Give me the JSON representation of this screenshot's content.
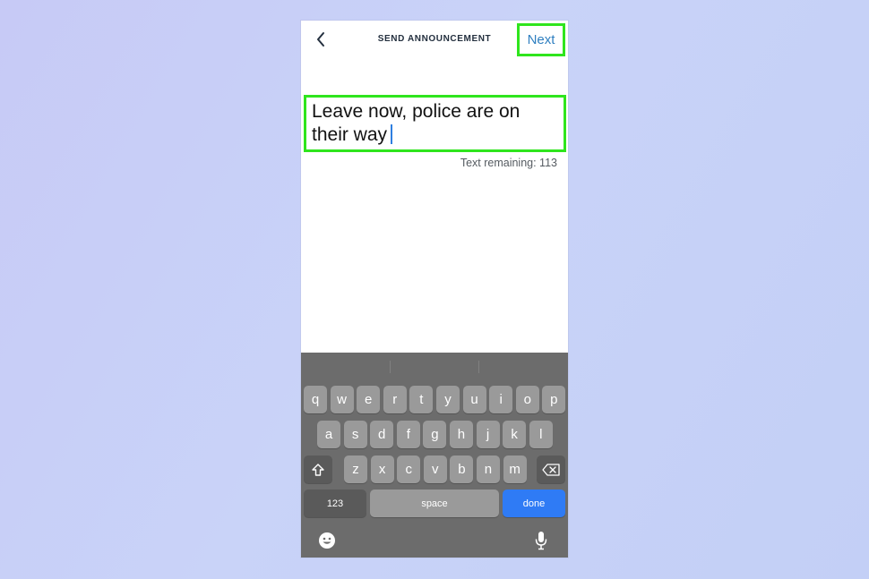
{
  "header": {
    "title": "SEND ANNOUNCEMENT",
    "next_label": "Next"
  },
  "message": {
    "text": "Leave now, police are on their way",
    "remaining": "Text remaining: 113"
  },
  "keyboard": {
    "row1": [
      "q",
      "w",
      "e",
      "r",
      "t",
      "y",
      "u",
      "i",
      "o",
      "p"
    ],
    "row2": [
      "a",
      "s",
      "d",
      "f",
      "g",
      "h",
      "j",
      "k",
      "l"
    ],
    "row3": [
      "z",
      "x",
      "c",
      "v",
      "b",
      "n",
      "m"
    ],
    "numbers_label": "123",
    "space_label": "space",
    "done_label": "done"
  },
  "icons": {
    "back": "chevron-left-icon",
    "shift": "shift-icon",
    "delete": "backspace-icon",
    "emoji": "emoji-icon",
    "mic": "microphone-icon"
  },
  "colors": {
    "highlight": "#2fe51d",
    "link": "#2f7fc0",
    "done_key": "#2f7bf5",
    "caret": "#2f7fe0"
  }
}
